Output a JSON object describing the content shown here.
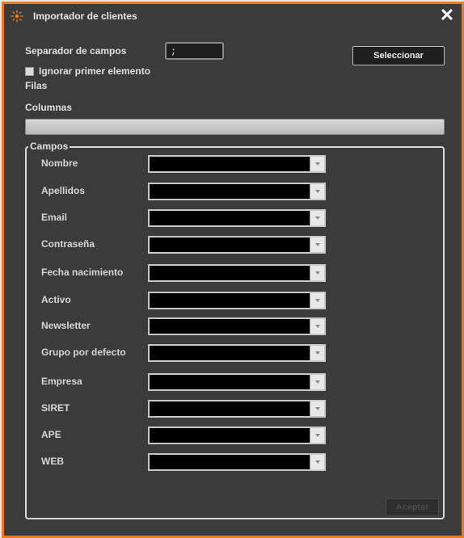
{
  "window": {
    "title": "Importador de clientes",
    "close_symbol": "✕"
  },
  "form": {
    "separator_label": "Separador de campos",
    "separator_value": ";",
    "select_button": "Seleccionar",
    "ignore_first_label": "Ignorar primer elemento",
    "rows_label": "Filas",
    "columns_label": "Columnas",
    "fieldset_legend": "Campos",
    "accept_button": "Aceptar"
  },
  "fields": [
    {
      "label": "Nombre",
      "value": ""
    },
    {
      "label": "Apellidos",
      "value": ""
    },
    {
      "label": "Email",
      "value": ""
    },
    {
      "label": "Contraseña",
      "value": ""
    },
    {
      "label": "Fecha nacimiento",
      "value": ""
    },
    {
      "label": "Activo",
      "value": ""
    },
    {
      "label": "Newsletter",
      "value": ""
    },
    {
      "label": "Grupo por defecto",
      "value": ""
    },
    {
      "label": "Empresa",
      "value": ""
    },
    {
      "label": "SIRET",
      "value": ""
    },
    {
      "label": "APE",
      "value": ""
    },
    {
      "label": "WEB",
      "value": ""
    }
  ],
  "colors": {
    "border_accent": "#f07a18",
    "background": "#3b3b3b"
  }
}
